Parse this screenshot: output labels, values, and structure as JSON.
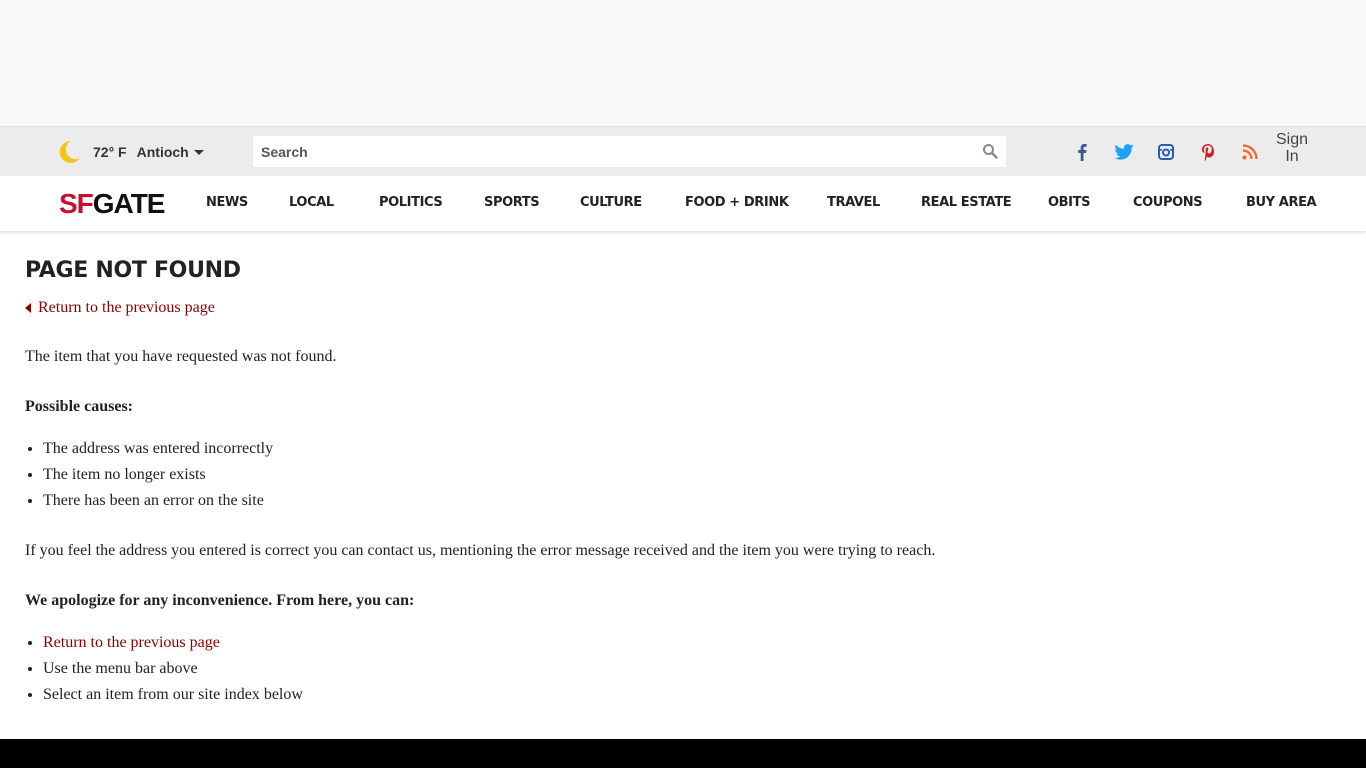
{
  "weather": {
    "temp": "72° F",
    "city": "Antioch"
  },
  "search": {
    "placeholder": "Search"
  },
  "signin": {
    "line1": "Sign",
    "line2": "In"
  },
  "logo": {
    "sf": "SF",
    "gate": "GATE"
  },
  "nav": {
    "items": [
      "NEWS",
      "LOCAL",
      "POLITICS",
      "SPORTS",
      "CULTURE",
      "FOOD + DRINK",
      "TRAVEL",
      "REAL ESTATE",
      "OBITS",
      "COUPONS",
      "BUY AREA"
    ]
  },
  "social": {
    "facebook": "#3b5998",
    "twitter": "#1da1f2",
    "instagram": "#2a5db0",
    "pinterest": "#cb2027",
    "rss": "#f26522"
  },
  "colors": {
    "link": "#8b0000",
    "moon": "#f5c518",
    "footer": "#000000"
  },
  "page": {
    "title": "PAGE NOT FOUND",
    "back_link": "Return to the previous page",
    "intro": "The item that you have requested was not found.",
    "causes_heading": "Possible causes:",
    "causes": [
      "The address was entered incorrectly",
      "The item no longer exists",
      "There has been an error on the site"
    ],
    "contact_text": "If you feel the address you entered is correct you can contact us, mentioning the error message received and the item you were trying to reach.",
    "apology_heading": "We apologize for any inconvenience. From here, you can:",
    "options": [
      "Return to the previous page",
      "Use the menu bar above",
      "Select an item from our site index below"
    ]
  }
}
